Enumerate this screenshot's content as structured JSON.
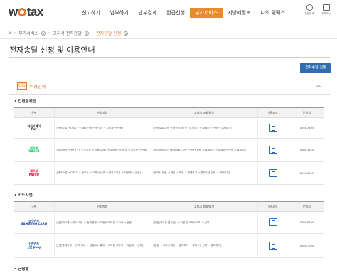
{
  "header": {
    "logo_pre": "w",
    "logo_post": "tax",
    "nav": [
      "신고하기",
      "납부하기",
      "납부결과",
      "환급신청",
      "부가서비스",
      "지방세정보",
      "나의 위택스"
    ],
    "nav_active_index": 4,
    "icons": [
      {
        "name": "notification",
        "label": "통합검색"
      },
      {
        "name": "menu",
        "label": "전체메뉴"
      }
    ]
  },
  "breadcrumb": {
    "items": [
      "부가서비스",
      "고지서 전자송달",
      "전자송달 신청"
    ]
  },
  "page_title": "전자송달 신청 및 이용안내",
  "apply_button": "전자송달 신청",
  "section": {
    "icon": "CIS",
    "label": "이용안내"
  },
  "tables": [
    {
      "category": "간편결제앱",
      "headers": [
        "구분",
        "신청방법",
        "고지서 조회/납부",
        "QR코드",
        "문의처"
      ],
      "rows": [
        {
          "brand": "카카오페이",
          "brand_sub": "Pay",
          "desc1": "[카카오톡 → 더보기 → pay 선택 → 청구서 → 지방세 → 신청]",
          "desc2": "[카카오톡 수신 → 청구서 보기 → 납부하기 → 결제수단 선택 → 결제하기]",
          "tel": "1544-7405"
        },
        {
          "brand": "네이버",
          "brand_sub": "NAVER",
          "desc1": "[네이버앱 → 상단(三) → 표고지 → 이용(결제) → 네이버 전자문서 → 지방세 → 신청]",
          "desc2": "[네이버앱 또는 네이버페이 수신 → 상단 알림 → 결제하기 → 결제수단 선택 → 결제하기]",
          "tel": "1588-3820"
        },
        {
          "brand": "페이코",
          "brand_sub": "PAYCO",
          "desc1": "[페이코앱 → 더보기 → 청구서 → 고지서·납부 → 전자고지서 → 지방세 → 신청]",
          "desc2": "[앱에서 알림 → 확인 → 확인 → 결제하기 → 결제수단 선택 → 결제하기]",
          "tel": "1544-6891"
        }
      ]
    },
    {
      "category": "카드사앱",
      "headers": [
        "구분",
        "신청방법",
        "고지서 조회/납부",
        "QR코드",
        "문의처"
      ],
      "rows": [
        {
          "brand": "삼성카드",
          "brand_sub": "SAMSUNG CARD",
          "desc1": "[삼성카드앱 → 전체 메뉴 → 정기결제 → 지방세 모바일 고지서 → 신청]",
          "desc2": "[알림(카드사 앱 수신) → 지방세 고지서 조회 → 납부]",
          "tel": "1588-8700"
        },
        {
          "brand": "신한카드",
          "brand_sub": "신한 pLay",
          "desc1": "[신한플레이앱 → 전체 메뉴 → 생활/Biz 결제 → 모바일 고지서 → 지방세 → 신청]",
          "desc2": "[알림 → 고지서 확인 → 결제하기 → 결제수단 선택 → 결제하기]",
          "tel": "1544-7000"
        }
      ]
    }
  ],
  "next_category": "금융앱",
  "colors": {
    "accent": "#e98a2d",
    "primary": "#2f6db0"
  }
}
